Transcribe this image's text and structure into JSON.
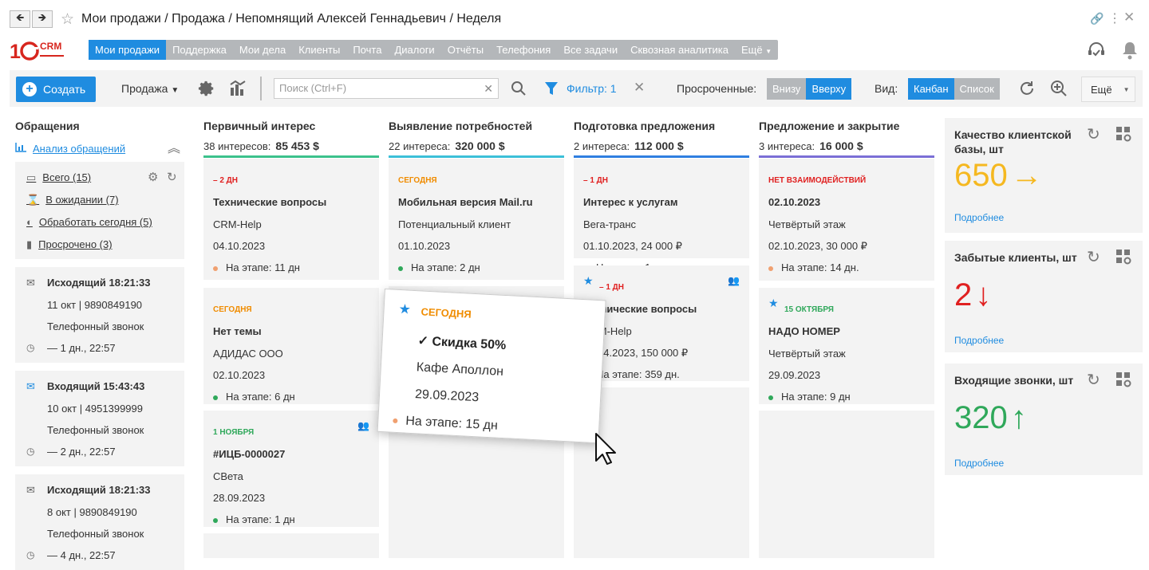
{
  "window": {
    "title": "Мои продажи / Продажа / Непомнящий Алексей Геннадьевич / Неделя"
  },
  "logo": {
    "text": "1C",
    "sub": "CRM"
  },
  "topnav": [
    "Мои продажи",
    "Поддержка",
    "Мои дела",
    "Клиенты",
    "Почта",
    "Диалоги",
    "Отчёты",
    "Телефония",
    "Все задачи",
    "Сквозная аналитика",
    "Ещё"
  ],
  "toolbar": {
    "create": "Создать",
    "mode": "Продажа",
    "search_placeholder": "Поиск (Ctrl+F)",
    "filter": "Фильтр: 1",
    "overdue_label": "Просроченные:",
    "overdue_options": [
      "Внизу",
      "Вверху"
    ],
    "overdue_selected": "Вверху",
    "view_label": "Вид:",
    "view_options": [
      "Канбан",
      "Список"
    ],
    "view_selected": "Канбан",
    "more": "Ещё"
  },
  "left": {
    "title": "Обращения",
    "analysis_link": "Анализ обращений",
    "filters": [
      "Всего (15)",
      "В ожидании (7)",
      "Обработать сегодня (5)",
      "Просрочено (3)"
    ],
    "calls": [
      {
        "title": "Исходящий 18:21:33",
        "info": "11 окт | 9890849190",
        "type": "Телефонный звонок",
        "ago": "— 1 дн., 22:57"
      },
      {
        "title": "Входящий 15:43:43",
        "info": "10 окт | 4951399999",
        "type": "Телефонный звонок",
        "ago": "— 2 дн., 22:57"
      },
      {
        "title": "Исходящий 18:21:33",
        "info": "8 окт | 9890849190",
        "type": "Телефонный звонок",
        "ago": "— 4 дн., 22:57"
      }
    ]
  },
  "columns": [
    {
      "title": "Первичный интерес",
      "count": "38 интересов:",
      "sum": "85 453 $",
      "color": "#3cc28c",
      "cards": [
        {
          "tag": "– 2 ДН",
          "tag_color": "#e02020",
          "title": "Технические вопросы",
          "client": "CRM-Help",
          "date": "04.10.2023",
          "stage": "На этапе: 11 дн",
          "dot": "#f0a070"
        },
        {
          "tag": "СЕГОДНЯ",
          "tag_color": "#f08c00",
          "title": "Нет темы",
          "client": "АДИДАС ООО",
          "date": "02.10.2023",
          "stage": "На этапе: 6 дн",
          "dot": "#2fa85a"
        },
        {
          "tag": "1 НОЯБРЯ",
          "tag_color": "#2fa85a",
          "title": "#ИЦБ-0000027",
          "client": "СВета",
          "date": "28.09.2023",
          "stage": "На этапе: 1 дн",
          "dot": "#2fa85a"
        }
      ]
    },
    {
      "title": "Выявление потребностей",
      "count": "22 интереса:",
      "sum": "320 000 $",
      "color": "#3cc0d8",
      "cards": [
        {
          "tag": "СЕГОДНЯ",
          "tag_color": "#f08c00",
          "title": "Мобильная версия Mail.ru",
          "client": "Потенциальный клиент",
          "date": "01.10.2023",
          "stage": "На этапе: 2 дн",
          "dot": "#2fa85a"
        }
      ]
    },
    {
      "title": "Подготовка предложения",
      "count": "2 интереса:",
      "sum": "112 000 $",
      "color": "#2f7fe0",
      "cards": [
        {
          "tag": "– 1 ДН",
          "tag_color": "#e02020",
          "title": "Интерес к услугам",
          "client": "Вега-транс",
          "date": "01.10.2023, 24 000 ₽",
          "stage": "На этапе: 1 дн",
          "dot": "#2fa85a"
        },
        {
          "tag": "– 1 ДН",
          "tag_color": "#e02020",
          "title": "Технические вопросы",
          "client": "CRM-Help",
          "date": "04.04.2023, 150 000 ₽",
          "stage": "На этапе: 359 дн.",
          "dot": "#f0a070"
        }
      ]
    },
    {
      "title": "Предложение и закрытие",
      "count": "3 интереса:",
      "sum": "16 000 $",
      "color": "#7b6fd6",
      "cards": [
        {
          "tag": "НЕТ ВЗАИМОДЕЙСТВИЙ",
          "tag_color": "#e02020",
          "title": "02.10.2023",
          "client": "Четвёртый этаж",
          "date": "02.10.2023, 30 000 ₽",
          "stage": "На этапе: 14 дн.",
          "dot": "#f0a070"
        },
        {
          "tag": "15 ОКТЯБРЯ",
          "tag_color": "#2fa85a",
          "title": "НАДО НОМЕР",
          "client": "Четвёртый этаж",
          "date": "29.09.2023",
          "stage": "На этапе: 9 дн",
          "dot": "#2fa85a"
        }
      ]
    }
  ],
  "drag_card": {
    "tag": "СЕГОДНЯ",
    "title": "✓ Скидка 50%",
    "client": "Кафе Аполлон",
    "date": "29.09.2023",
    "stage": "На этапе: 15 дн"
  },
  "widgets": [
    {
      "title": "Качество клиентской базы, шт",
      "value": "650",
      "arrow": "→",
      "color": "#f5b820",
      "more": "Подробнее"
    },
    {
      "title": "Забытые клиенты, шт",
      "value": "2",
      "arrow": "↓",
      "color": "#e02020",
      "more": "Подробнее"
    },
    {
      "title": "Входящие звонки, шт",
      "value": "320",
      "arrow": "↑",
      "color": "#2fa85a",
      "more": "Подробнее"
    }
  ]
}
